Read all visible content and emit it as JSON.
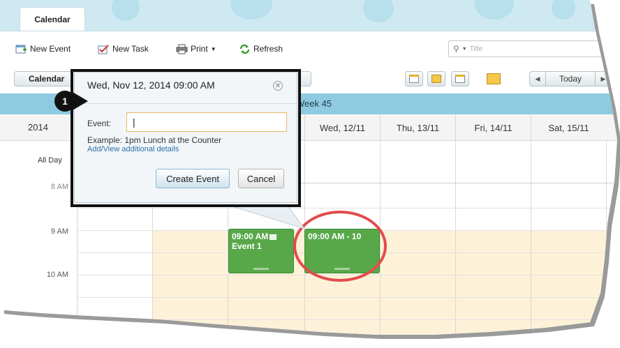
{
  "tab": {
    "label": "Calendar"
  },
  "toolbar": {
    "new_event": "New Event",
    "new_task": "New Task",
    "print": "Print",
    "refresh": "Refresh",
    "search_placeholder": "Title"
  },
  "viewbar": {
    "calendar_button": "Calendar",
    "today": "Today"
  },
  "week": {
    "label": "Week 45",
    "year": "2014",
    "days": [
      "Wed, 12/11",
      "Thu, 13/11",
      "Fri, 14/11",
      "Sat, 15/11"
    ]
  },
  "grid": {
    "all_day": "All Day",
    "partial_time": "8 AM",
    "time_9": "9 AM",
    "time_10": "10 AM"
  },
  "events": {
    "event1_time": "09:00 AM",
    "event1_title": "Event 1",
    "event2_time": "09:00 AM - 10"
  },
  "popup": {
    "title": "Wed, Nov 12, 2014 09:00 AM",
    "event_label": "Event:",
    "event_value": "|",
    "example": "Example: 1pm Lunch at the Counter",
    "details_link": "Add/View additional details",
    "create": "Create Event",
    "cancel": "Cancel"
  },
  "step_number": "1",
  "colors": {
    "event_green": "#58a84a",
    "week_bar": "#8ecbe0",
    "work_hours": "#fdf2d8",
    "highlight_red": "#e34b4b"
  }
}
